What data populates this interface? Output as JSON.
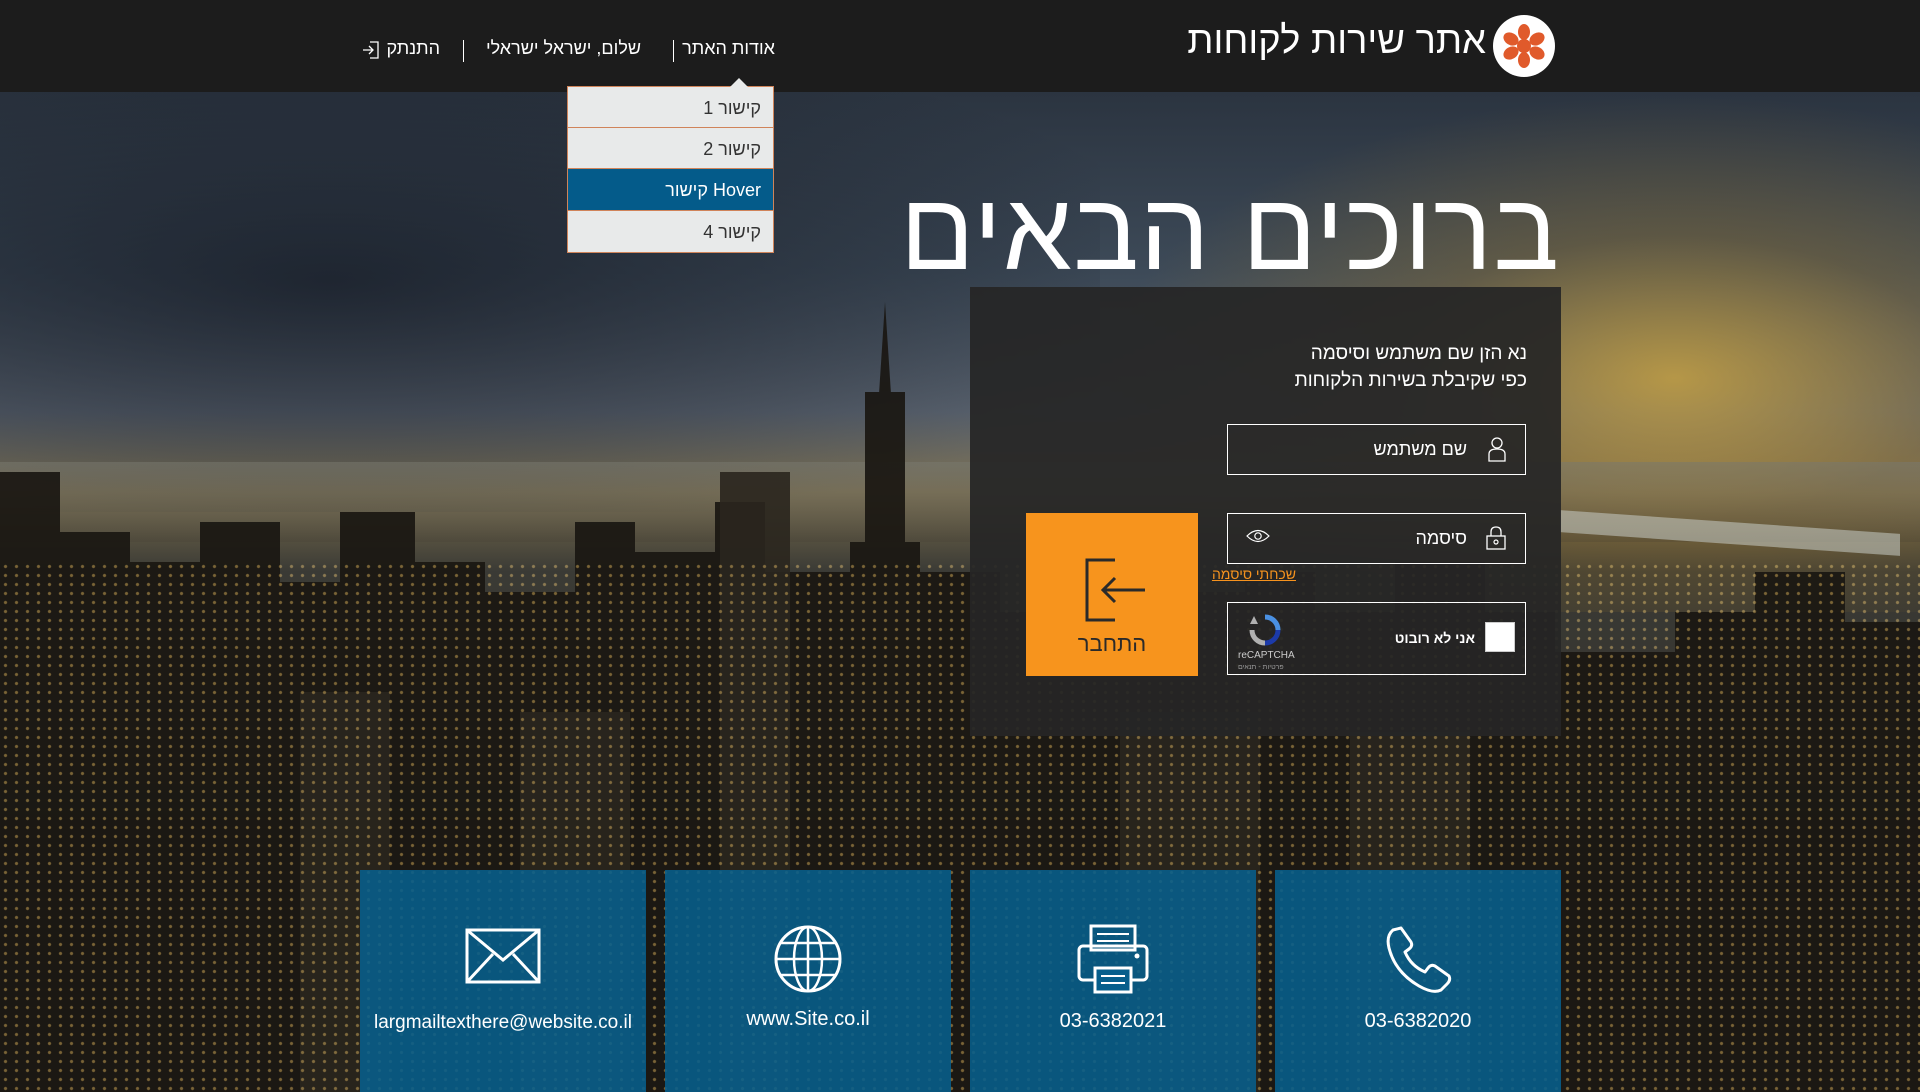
{
  "header": {
    "site_title": "אתר שירות לקוחות",
    "nav": {
      "about": "אודות האתר",
      "greeting": "שלום, ישראל ישראלי",
      "logout": "התנתק"
    },
    "dropdown": [
      "קישור 1",
      "קישור 2",
      "Hover קישור",
      "קישור 4"
    ]
  },
  "welcome": "ברוכים הבאים",
  "login": {
    "instructions_line1": "נא הזן שם משתמש וסיסמה",
    "instructions_line2": "כפי שקיבלת בשירות הלקוחות",
    "username_placeholder": "שם משתמש",
    "password_placeholder": "סיסמה",
    "forgot_password": "שכחתי סיסמה",
    "captcha_label": "אני לא רובוט",
    "captcha_brand": "reCAPTCHA",
    "captcha_sub": "פרטיות - תנאים",
    "submit": "התחבר"
  },
  "contacts": [
    {
      "icon": "phone-icon",
      "text": "03-6382020"
    },
    {
      "icon": "fax-icon",
      "text": "03-6382021"
    },
    {
      "icon": "globe-icon",
      "text": "www.Site.co.il"
    },
    {
      "icon": "mail-icon",
      "text": "largmailtexthere@website.co.il"
    }
  ],
  "colors": {
    "header_bg": "#1c1c1c",
    "accent_orange": "#f7941d",
    "tile_blue": "#075f8c",
    "dropdown_hover": "#045b8a",
    "logo_red": "#e05a2b"
  }
}
